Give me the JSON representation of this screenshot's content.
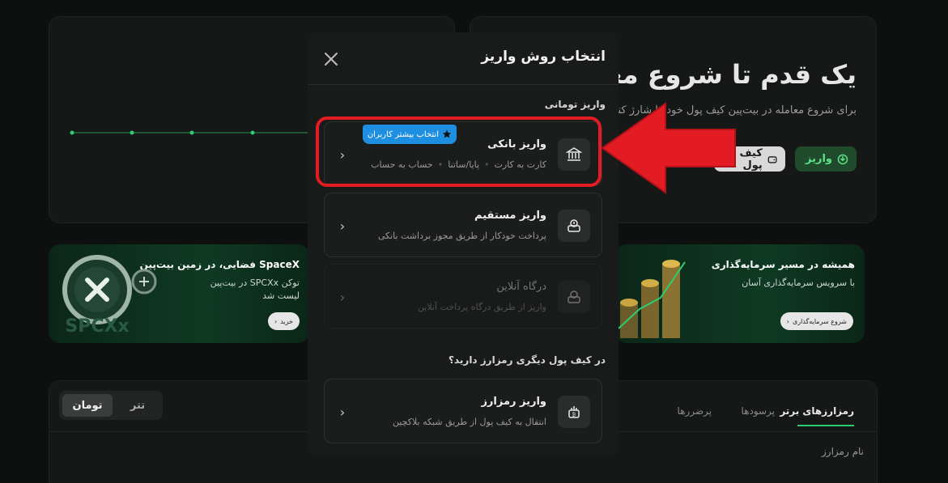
{
  "background": {
    "hero": {
      "title": "یک قدم تا شروع معامله",
      "subtitle": "برای شروع معامله در بیت‌پین کیف پول خود را شارژ کنید",
      "deposit_button": "واریز",
      "wallet_button": "کیف پول"
    },
    "banner_left": {
      "title": "SpaceX فضایی، در زمین بیت‌پین",
      "subtitle_line1": "توکن SPCXx در بیت‌پین",
      "subtitle_line2": "لیست شد",
      "button": "خرید",
      "coin_text": "SPCXx"
    },
    "banner_right": {
      "title": "همیشه در مسیر سرمایه‌گذاری",
      "subtitle": "با سرویس سرمایه‌گذاری آسان",
      "button": "شروع سرمایه‌گذاری"
    },
    "market": {
      "tabs": [
        "رمزارزهای برتر",
        "پرسودها",
        "پرضررها"
      ],
      "currency_options": [
        "تومان",
        "تتر"
      ],
      "column_name": "نام رمزارز"
    }
  },
  "modal": {
    "title": "انتخاب روش واریز",
    "section_toman": "واریز تومانی",
    "section_crypto": "در کیف پول دیگری رمزارز دارید؟",
    "popular_badge": "انتخاب بیشتر کاربران",
    "options": [
      {
        "title": "واریز بانکی",
        "tags": [
          "کارت به کارت",
          "پایا/ساتنا",
          "حساب به حساب"
        ],
        "icon": "bank-icon"
      },
      {
        "title": "واریز مستقیم",
        "description": "پرداخت خودکار از طریق مجوز برداشت بانکی",
        "icon": "direct-deposit-icon"
      },
      {
        "title": "درگاه آنلاین",
        "description": "واریز از طریق درگاه پرداخت آنلاین",
        "icon": "gateway-icon",
        "disabled": true
      },
      {
        "title": "واریز رمزارز",
        "description": "انتقال به کیف پول از طریق شبکه بلاکچین",
        "icon": "crypto-deposit-icon"
      }
    ]
  },
  "colors": {
    "highlight": "#e31b23",
    "badge": "#1e8fe0",
    "accent_green": "#2ecc71"
  }
}
